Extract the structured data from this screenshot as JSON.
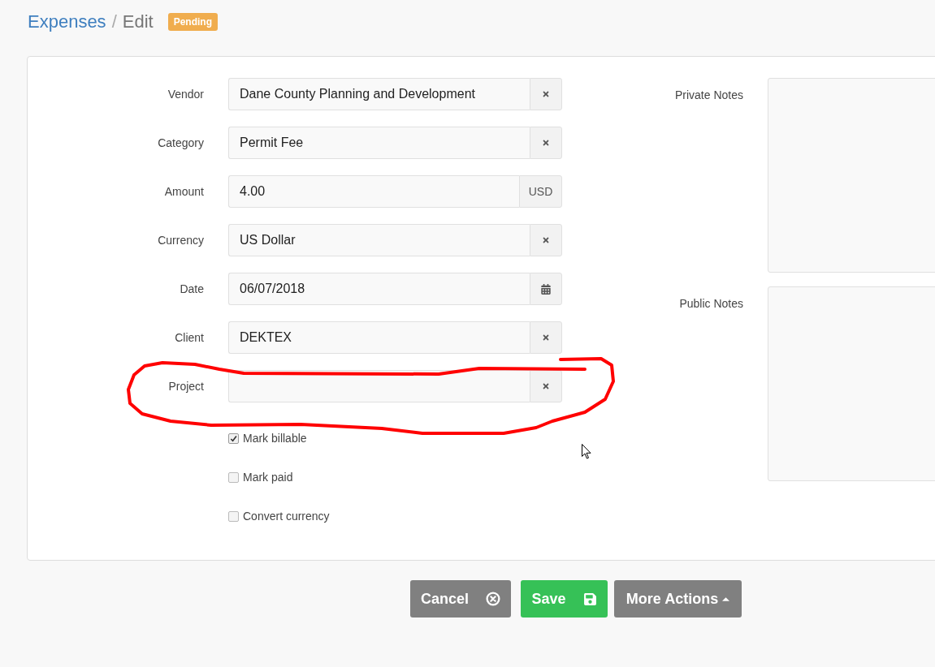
{
  "breadcrumb": {
    "items": [
      {
        "label": "Expenses",
        "kind": "link"
      },
      {
        "label": "Edit",
        "kind": "current"
      }
    ],
    "separator": "/",
    "status_badge": "Pending"
  },
  "form": {
    "fields": [
      {
        "label": "Vendor",
        "value": "Dane County Planning and Development",
        "kind": "clear"
      },
      {
        "label": "Category",
        "value": "Permit Fee",
        "kind": "clear"
      },
      {
        "label": "Amount",
        "value": "4.00",
        "kind": "addon",
        "addon_text": "USD"
      },
      {
        "label": "Currency",
        "value": "US Dollar",
        "kind": "clear"
      },
      {
        "label": "Date",
        "value": "06/07/2018",
        "kind": "calendar"
      },
      {
        "label": "Client",
        "value": "DEKTEX",
        "kind": "clear"
      },
      {
        "label": "Project",
        "kind": "clear"
      }
    ],
    "checkboxes": [
      {
        "label": "Mark billable",
        "checked": true
      },
      {
        "label": "Mark paid",
        "checked": false
      },
      {
        "label": "Convert currency",
        "checked": false
      }
    ],
    "notes": [
      {
        "label": "Private Notes"
      },
      {
        "label": "Public Notes"
      }
    ]
  },
  "buttons": [
    {
      "label": "Cancel",
      "kind": "cancel"
    },
    {
      "label": "Save",
      "kind": "save"
    },
    {
      "label": "More Actions",
      "kind": "dropdown"
    }
  ]
}
